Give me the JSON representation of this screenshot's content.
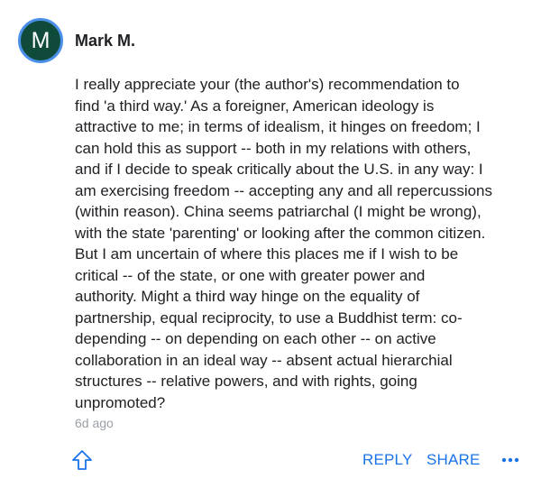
{
  "comment": {
    "avatar_initial": "M",
    "author": "Mark M.",
    "body": "I really appreciate your (the author's) recommendation to\nfind 'a third way.' As a foreigner, American ideology is\nattractive to me; in terms of idealism, it hinges on freedom; I\ncan hold this as support -- both in my relations with others,\nand if I decide to speak critically about the U.S. in any way: I\nam exercising freedom -- accepting any and all repercussions\n(within reason). China seems patriarchal (I might be wrong),\nwith the state 'parenting' or looking after the common citizen.\nBut I am uncertain of where this places me if I wish to be\ncritical -- of the state, or one with greater power and\nauthority. Might a third way hinge on the equality of\npartnership, equal reciprocity, to use a Buddhist term: co-\ndepending -- on depending on each other -- on active\ncollaboration in an ideal way -- absent actual hierarchial\nstructures -- relative powers, and with rights, going\nunpromoted?",
    "timestamp": "6d ago"
  },
  "actions": {
    "upvote_icon": "upvote-arrow-icon",
    "reply_label": "REPLY",
    "share_label": "SHARE",
    "more_icon": "more-horizontal-icon"
  },
  "colors": {
    "avatar_bg": "#0f4a3a",
    "avatar_ring": "#4a8fe8",
    "accent": "#1a73e8",
    "muted": "#9aa0a6",
    "text": "#202124"
  }
}
